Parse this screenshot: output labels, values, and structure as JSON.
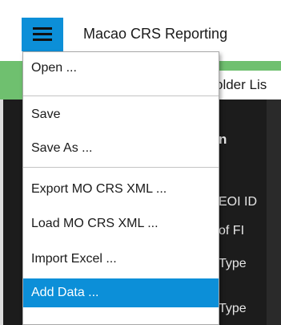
{
  "app": {
    "title": "Macao CRS Reporting",
    "hamburger_icon": "hamburger-menu-icon",
    "accent_color": "#0c8fd8",
    "strip_color": "#6fc06f"
  },
  "tabs": {
    "folder_list_label": "older Lis"
  },
  "background_labels": {
    "header": "n",
    "eoi_id": "EOI ID",
    "of_fi": "of FI",
    "type_1": "Type",
    "type_2": "Type"
  },
  "menu": {
    "items": [
      {
        "label": "Open ..."
      },
      {
        "label": "Save"
      },
      {
        "label": "Save As ..."
      },
      {
        "label": "Export MO CRS XML ..."
      },
      {
        "label": "Load MO CRS XML ..."
      },
      {
        "label": "Import Excel ..."
      },
      {
        "label": "Add Data ..."
      }
    ],
    "active_item": "Add Data ..."
  }
}
